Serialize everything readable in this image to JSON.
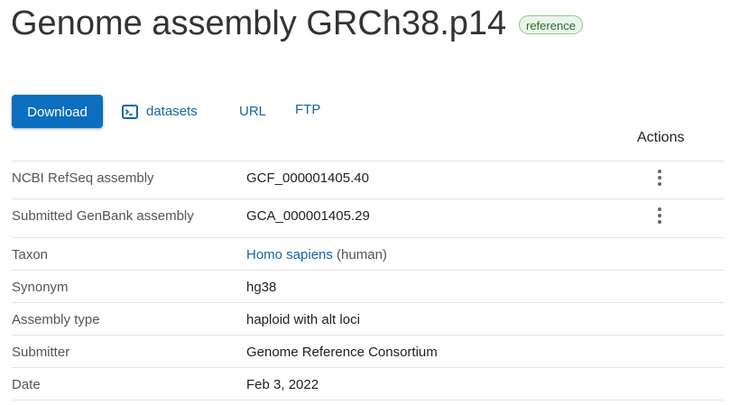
{
  "header": {
    "title": "Genome assembly GRCh38.p14",
    "badge": "reference"
  },
  "toolbar": {
    "download_label": "Download",
    "datasets_label": "datasets",
    "datasets_icon": "terminal-icon",
    "url_label": "URL",
    "ftp_label": "FTP"
  },
  "table": {
    "actions_header": "Actions",
    "rows": [
      {
        "label": "NCBI RefSeq assembly",
        "value": "GCF_000001405.40"
      },
      {
        "label": "Submitted GenBank assembly",
        "value": "GCA_000001405.29"
      },
      {
        "label": "Taxon",
        "value_link": "Homo sapiens",
        "value_suffix": " (human)"
      },
      {
        "label": "Synonym",
        "value": "hg38"
      },
      {
        "label": "Assembly type",
        "value": "haploid with alt loci"
      },
      {
        "label": "Submitter",
        "value": "Genome Reference Consortium"
      },
      {
        "label": "Date",
        "value": "Feb 3, 2022"
      }
    ]
  },
  "colors": {
    "primary": "#0b6ebf",
    "link": "#1565a6",
    "badge_bg": "#eaf5ea",
    "badge_border": "#8cc98d"
  }
}
